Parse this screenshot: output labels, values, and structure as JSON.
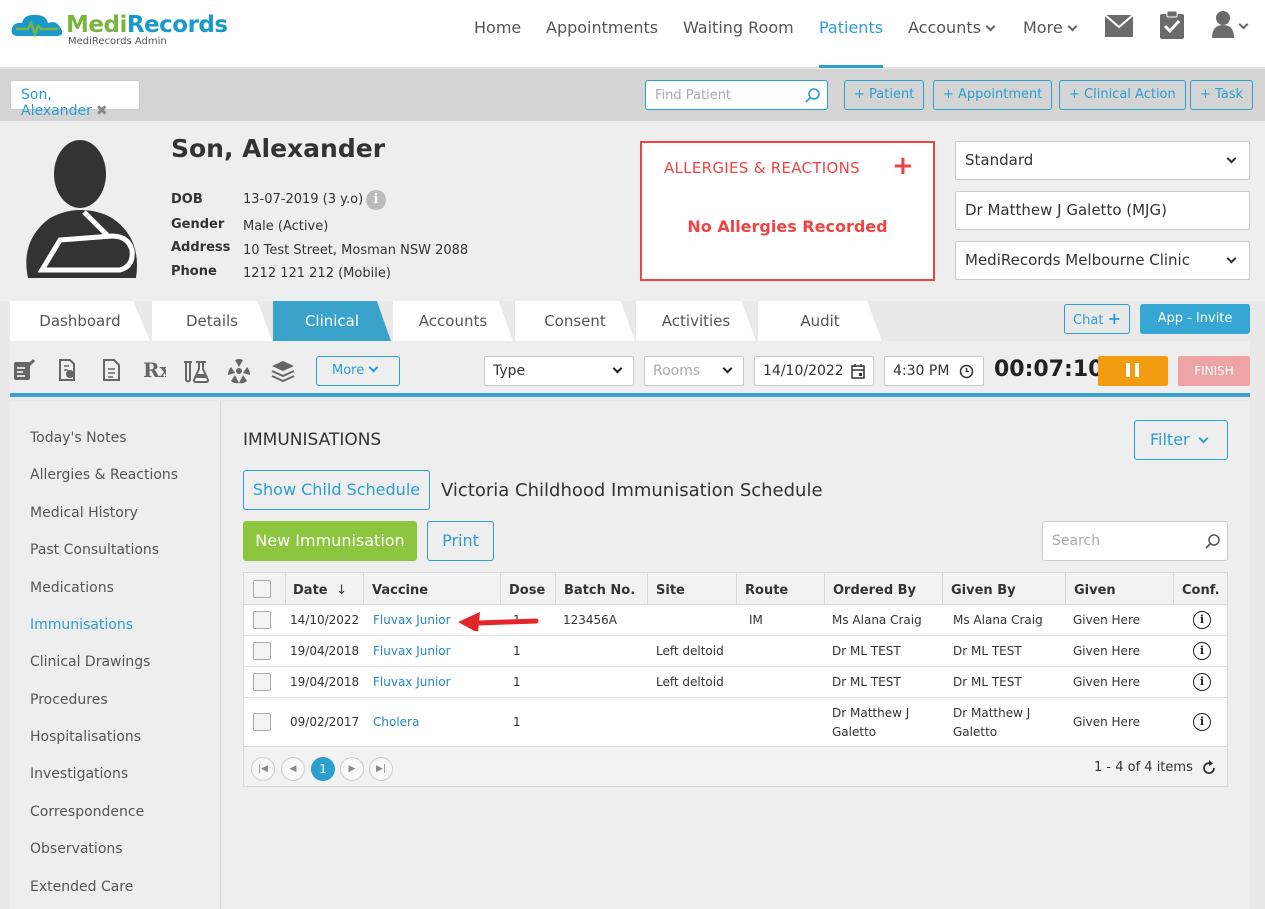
{
  "brand": {
    "name_part1": "Medi",
    "name_part2": "Records",
    "subtitle": "MediRecords Admin"
  },
  "nav": {
    "items": [
      {
        "label": "Home"
      },
      {
        "label": "Appointments"
      },
      {
        "label": "Waiting Room"
      },
      {
        "label": "Patients"
      },
      {
        "label": "Accounts"
      },
      {
        "label": "More"
      }
    ]
  },
  "patient_bar": {
    "open_patient": "Son, Alexander",
    "search_placeholder": "Find Patient",
    "add_patient": "+ Patient",
    "add_appointment": "+ Appointment",
    "add_clinical_action": "+ Clinical Action",
    "add_task": "+ Task"
  },
  "patient": {
    "name": "Son, Alexander",
    "dob_label": "DOB",
    "dob": "13-07-2019 (3 y.o)",
    "gender_label": "Gender",
    "gender": "Male (Active)",
    "address_label": "Address",
    "address": "10 Test Street, Mosman NSW 2088",
    "phone_label": "Phone",
    "phone": "1212 121 212 (Mobile)"
  },
  "allergies": {
    "title": "ALLERGIES & REACTIONS",
    "plus": "+",
    "message": "No Allergies Recorded"
  },
  "selectors": {
    "billing": "Standard",
    "doctor": "Dr Matthew J Galetto (MJG)",
    "clinic": "MediRecords Melbourne Clinic"
  },
  "tabs": [
    {
      "label": "Dashboard"
    },
    {
      "label": "Details"
    },
    {
      "label": "Clinical"
    },
    {
      "label": "Accounts"
    },
    {
      "label": "Consent"
    },
    {
      "label": "Activities"
    },
    {
      "label": "Audit"
    }
  ],
  "actions": {
    "chat": "Chat",
    "app_invite": "App - Invite"
  },
  "toolbar": {
    "more": "More",
    "type": "Type",
    "rooms": "Rooms",
    "date": "14/10/2022",
    "time": "4:30 PM",
    "timer": "00:07:10",
    "finish": "FINISH"
  },
  "sidebar": {
    "items": [
      {
        "label": "Today's Notes"
      },
      {
        "label": "Allergies & Reactions"
      },
      {
        "label": "Medical History"
      },
      {
        "label": "Past Consultations"
      },
      {
        "label": "Medications"
      },
      {
        "label": "Immunisations"
      },
      {
        "label": "Clinical Drawings"
      },
      {
        "label": "Procedures"
      },
      {
        "label": "Hospitalisations"
      },
      {
        "label": "Investigations"
      },
      {
        "label": "Correspondence"
      },
      {
        "label": "Observations"
      },
      {
        "label": "Extended Care"
      }
    ]
  },
  "immunisations": {
    "title": "IMMUNISATIONS",
    "filter": "Filter",
    "show_schedule": "Show Child Schedule",
    "schedule_name": "Victoria Childhood Immunisation Schedule",
    "new_button": "New Immunisation",
    "print": "Print",
    "search_placeholder": "Search",
    "columns": [
      "Date",
      "Vaccine",
      "Dose",
      "Batch No.",
      "Site",
      "Route",
      "Ordered By",
      "Given By",
      "Given",
      "Conf."
    ],
    "rows": [
      {
        "date": "14/10/2022",
        "vaccine": "Fluvax Junior",
        "dose": "1",
        "batch": "123456A",
        "site": "",
        "route": "IM",
        "ordered_by": "Ms Alana Craig",
        "given_by": "Ms Alana Craig",
        "given": "Given Here"
      },
      {
        "date": "19/04/2018",
        "vaccine": "Fluvax Junior",
        "dose": "1",
        "batch": "",
        "site": "Left deltoid",
        "route": "",
        "ordered_by": "Dr ML TEST",
        "given_by": "Dr ML TEST",
        "given": "Given Here"
      },
      {
        "date": "19/04/2018",
        "vaccine": "Fluvax Junior",
        "dose": "1",
        "batch": "",
        "site": "Left deltoid",
        "route": "",
        "ordered_by": "Dr ML TEST",
        "given_by": "Dr ML TEST",
        "given": "Given Here"
      },
      {
        "date": "09/02/2017",
        "vaccine": "Cholera",
        "dose": "1",
        "batch": "",
        "site": "",
        "route": "",
        "ordered_by_1": "Dr Matthew J",
        "ordered_by_2": "Galetto",
        "given_by_1": "Dr Matthew J",
        "given_by_2": "Galetto",
        "given": "Given Here"
      }
    ],
    "pager": {
      "current_page": "1",
      "info": "1 - 4 of 4 items"
    }
  },
  "colors": {
    "accent": "#2a9fd0",
    "brand_green": "#7bb540",
    "alert_red": "#e44444",
    "new_green": "#8cc63f",
    "pause_orange": "#f39c12"
  }
}
